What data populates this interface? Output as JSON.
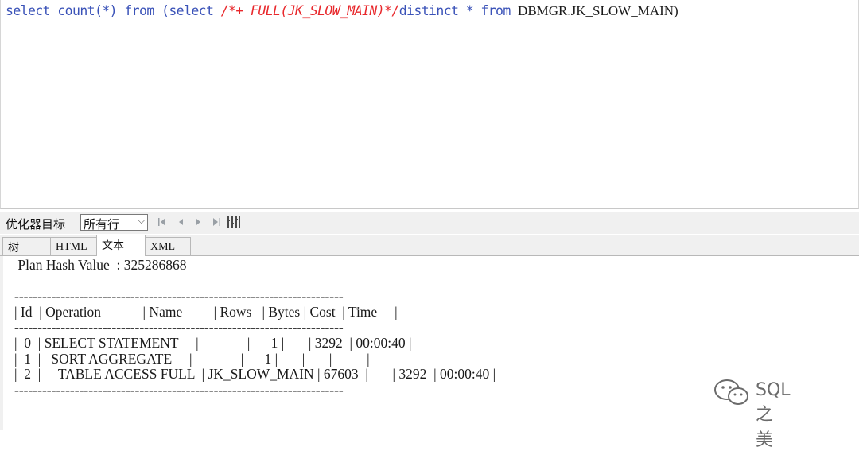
{
  "editor": {
    "sql": {
      "kw1": "select count(*) from (select ",
      "hint": "/*+ FULL(JK_SLOW_MAIN)*/",
      "kw2": "distinct * from ",
      "obj": "DBMGR.JK_SLOW_MAIN)"
    }
  },
  "toolbar": {
    "label": "优化器目标",
    "select_value": "所有行",
    "icons": [
      "first-icon",
      "prev-icon",
      "next-icon",
      "last-icon",
      "columns-icon"
    ]
  },
  "tabs": [
    {
      "label": "树"
    },
    {
      "label": "HTML"
    },
    {
      "label": "文本",
      "active": true
    },
    {
      "label": "XML"
    }
  ],
  "plan": {
    "lines": [
      " Plan Hash Value  : 325286868",
      "",
      "-----------------------------------------------------------------------",
      "| Id  | Operation            | Name         | Rows   | Bytes | Cost  | Time     |",
      "-----------------------------------------------------------------------",
      "|  0  | SELECT STATEMENT     |              |      1 |       | 3292  | 00:00:40 |",
      "|  1  |   SORT AGGREGATE     |              |      1 |       |       |          |",
      "|  2  |     TABLE ACCESS FULL  | JK_SLOW_MAIN | 67603  |       | 3292  | 00:00:40 |",
      "-----------------------------------------------------------------------"
    ]
  },
  "watermark": {
    "text": "SQL之美"
  }
}
